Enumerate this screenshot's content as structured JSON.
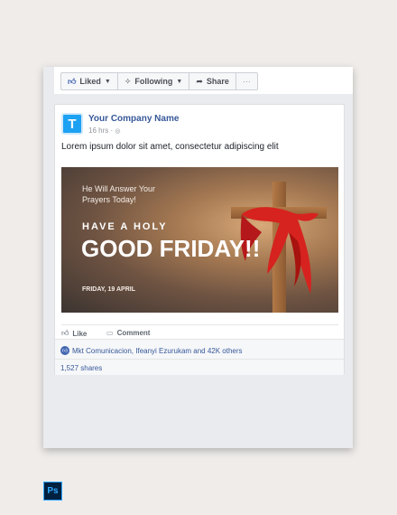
{
  "toolbar": {
    "liked_label": "Liked",
    "following_label": "Following",
    "share_label": "Share",
    "more_label": "···"
  },
  "post": {
    "avatar_letter": "T",
    "company_name": "Your Company Name",
    "timestamp": "16 hrs",
    "privacy_separator": "·",
    "text": "Lorem ipsum dolor sit amet, consectetur adipiscing elit"
  },
  "banner": {
    "subtitle_line1": "He Will Answer Your",
    "subtitle_line2": "Prayers Today!",
    "headline_small": "HAVE A HOLY",
    "headline_big": "GOOD FRIDAY!!",
    "date": "FRIDAY, 19 APRIL",
    "colors": {
      "cross": "#a06c3f",
      "cloth": "#d6231f",
      "text": "#ffffff"
    }
  },
  "actions": {
    "like_label": "Like",
    "comment_label": "Comment"
  },
  "reactions": {
    "summary": "Mkt Comunicacion, Ifeanyi Ezurukam and 42K others",
    "shares": "1,527 shares"
  },
  "badge": {
    "label": "Ps"
  },
  "colors": {
    "accent": "#4267b2",
    "link": "#365899",
    "ps_blue": "#31a8ff"
  }
}
